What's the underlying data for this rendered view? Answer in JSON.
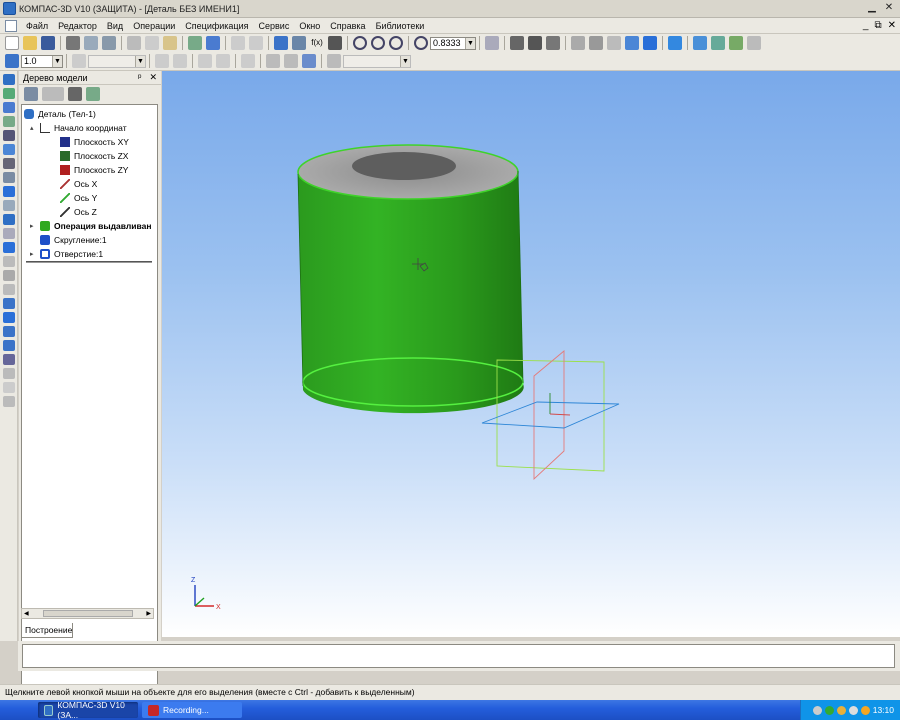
{
  "window": {
    "title": "КОМПАС-3D V10 (ЗАЩИТА) - [Деталь БЕЗ ИМЕНИ1]"
  },
  "menu": [
    "Файл",
    "Редактор",
    "Вид",
    "Операции",
    "Спецификация",
    "Сервис",
    "Окно",
    "Справка",
    "Библиотеки"
  ],
  "toolbar": {
    "zoom_value": "0.8333",
    "line_step_value": "1.0"
  },
  "tree": {
    "title": "Дерево модели",
    "items": [
      {
        "label": "Деталь (Тел-1)"
      },
      {
        "label": "Начало координат"
      },
      {
        "label": "Плоскость XY"
      },
      {
        "label": "Плоскость ZX"
      },
      {
        "label": "Плоскость ZY"
      },
      {
        "label": "Ось X"
      },
      {
        "label": "Ось Y"
      },
      {
        "label": "Ось Z"
      },
      {
        "label": "Операция выдавливан"
      },
      {
        "label": "Скругление:1"
      },
      {
        "label": "Отверстие:1"
      }
    ],
    "tab_label": "Построение"
  },
  "viewport": {
    "axis_z": "Z",
    "axis_x": "X"
  },
  "status": {
    "hint": "Щелкните левой кнопкой мыши на объекте для его выделения (вместе с Ctrl - добавить к выделенным)"
  },
  "taskbar": {
    "tasks": [
      {
        "label": "КОМПАС-3D V10 (ЗА..."
      },
      {
        "label": "Recording..."
      }
    ],
    "clock": "13:10"
  },
  "colors": {
    "model_green": "#2fa81f",
    "viewport_top": "#79a9ea",
    "viewport_bottom": "#ffffff",
    "taskbar_blue": "#245edc"
  }
}
